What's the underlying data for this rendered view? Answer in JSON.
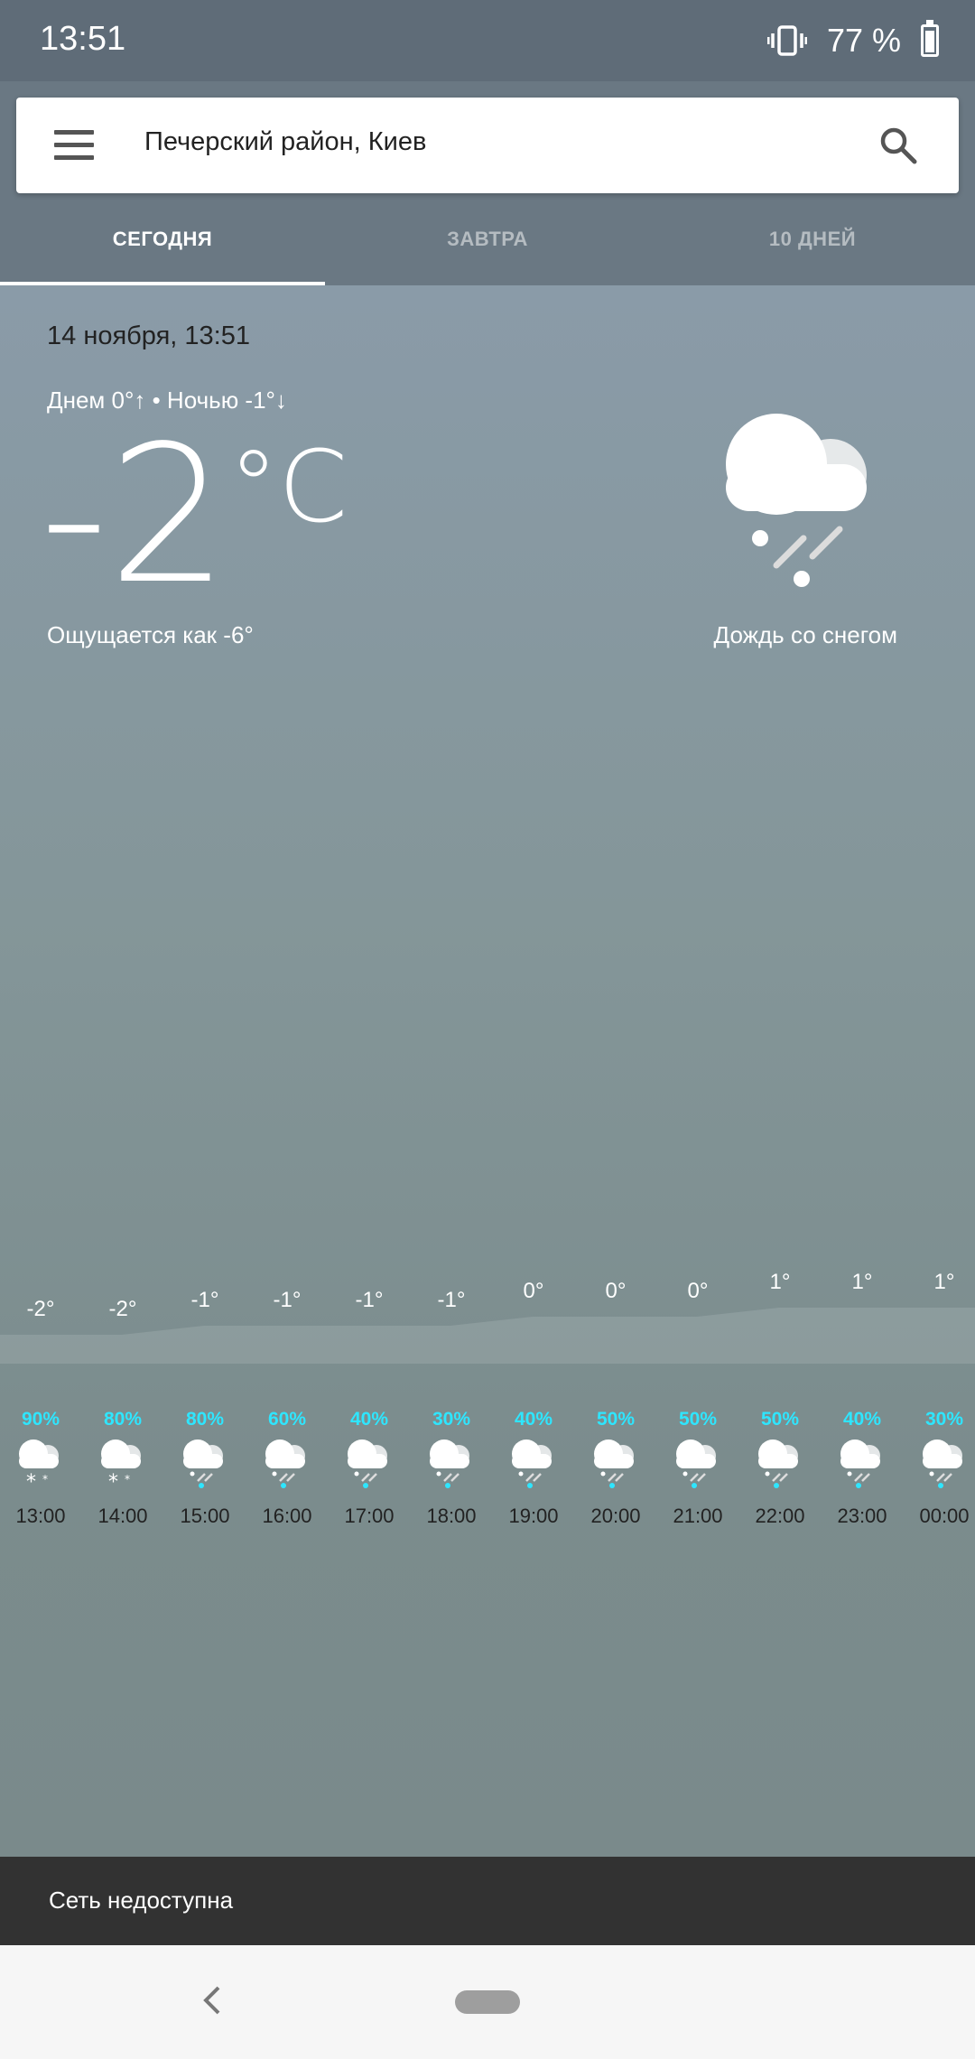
{
  "status": {
    "time": "13:51",
    "battery": "77 %"
  },
  "search": {
    "location": "Печерский район, Киев"
  },
  "tabs": [
    {
      "label": "СЕГОДНЯ"
    },
    {
      "label": "ЗАВТРА"
    },
    {
      "label": "10 ДНЕЙ"
    }
  ],
  "current": {
    "date": "14 ноября, 13:51",
    "day_night": "Днем 0°↑ • Ночью -1°↓",
    "temp": "-2",
    "unit": "°C",
    "feels_like": "Ощущается как -6°",
    "condition": "Дождь со снегом",
    "condition_icon": "sleet-icon"
  },
  "hourly": [
    {
      "temp": "-2°",
      "t": -2,
      "prob": "90%",
      "icon": "snow",
      "time": "13:00"
    },
    {
      "temp": "-2°",
      "t": -2,
      "prob": "80%",
      "icon": "snow",
      "time": "14:00"
    },
    {
      "temp": "-1°",
      "t": -1,
      "prob": "80%",
      "icon": "sleet",
      "time": "15:00"
    },
    {
      "temp": "-1°",
      "t": -1,
      "prob": "60%",
      "icon": "sleet",
      "time": "16:00"
    },
    {
      "temp": "-1°",
      "t": -1,
      "prob": "40%",
      "icon": "sleet",
      "time": "17:00"
    },
    {
      "temp": "-1°",
      "t": -1,
      "prob": "30%",
      "icon": "sleet",
      "time": "18:00"
    },
    {
      "temp": "0°",
      "t": 0,
      "prob": "40%",
      "icon": "sleet",
      "time": "19:00"
    },
    {
      "temp": "0°",
      "t": 0,
      "prob": "50%",
      "icon": "sleet",
      "time": "20:00"
    },
    {
      "temp": "0°",
      "t": 0,
      "prob": "50%",
      "icon": "sleet",
      "time": "21:00"
    },
    {
      "temp": "1°",
      "t": 1,
      "prob": "50%",
      "icon": "sleet",
      "time": "22:00"
    },
    {
      "temp": "1°",
      "t": 1,
      "prob": "40%",
      "icon": "sleet",
      "time": "23:00"
    },
    {
      "temp": "1°",
      "t": 1,
      "prob": "30%",
      "icon": "sleet",
      "time": "00:00"
    }
  ],
  "snackbar": {
    "message": "Сеть недоступна"
  },
  "colors": {
    "precip": "#2ee6ff",
    "status_bar": "#5f6c78",
    "snackbar": "#323232"
  }
}
